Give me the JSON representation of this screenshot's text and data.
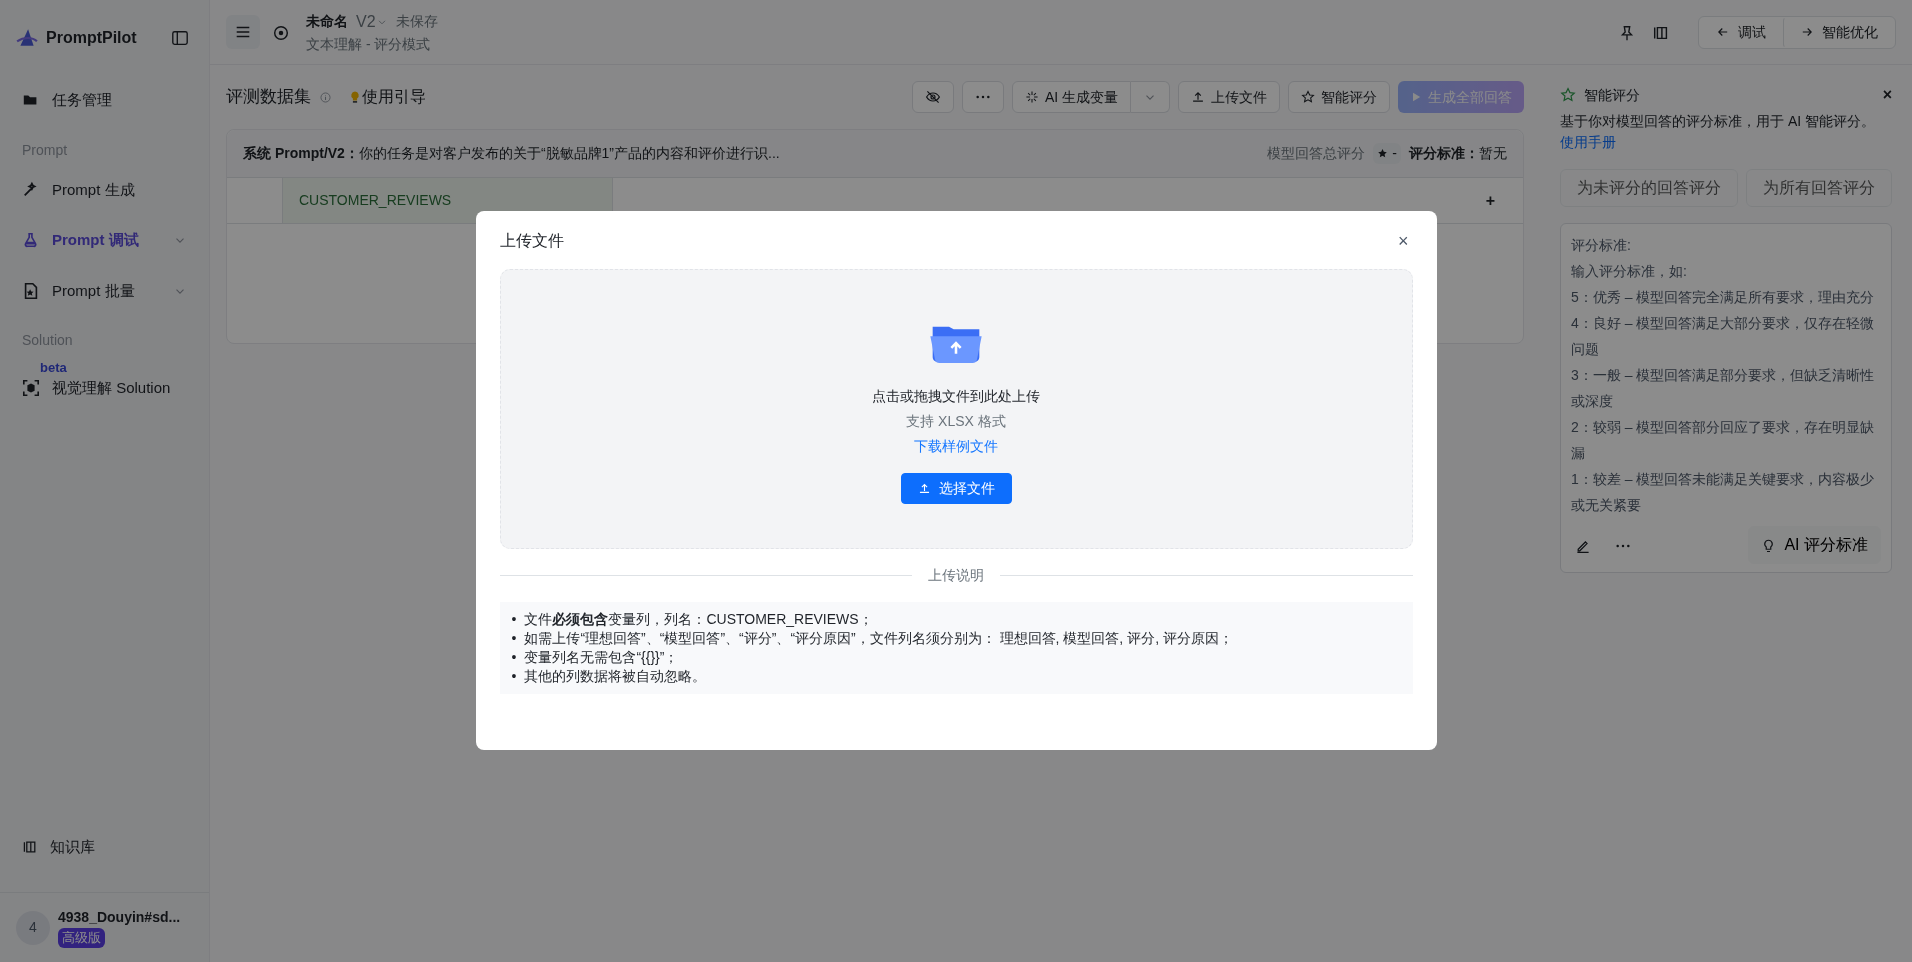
{
  "sidebar": {
    "logo": "PromptPilot",
    "items": [
      {
        "label": "任务管理",
        "selected": false,
        "collapsible": false
      },
      {
        "section": "Prompt"
      },
      {
        "label": "Prompt 生成",
        "selected": false,
        "collapsible": false
      },
      {
        "label": "Prompt 调试",
        "selected": true,
        "collapsible": true
      },
      {
        "label": "Prompt 批量",
        "selected": false,
        "collapsible": true
      },
      {
        "section": "Solution"
      },
      {
        "label": "视觉理解 Solution",
        "selected": false,
        "collapsible": false,
        "badge": "beta"
      }
    ],
    "bottom_item": {
      "label": "知识库"
    },
    "user": {
      "avatar": "4",
      "name": "4938_Douyin#sd...",
      "plan": "高级版"
    }
  },
  "header": {
    "title": "未命名",
    "version": "V2",
    "status": "未保存",
    "subtitle": "文本理解 - 评分模式",
    "buttons": [
      {
        "label": "调试"
      },
      {
        "label": "智能优化"
      }
    ]
  },
  "dataset": {
    "title": "评测数据集",
    "guide": "使用引导",
    "toolbar": [
      {
        "kind": "icon"
      },
      {
        "kind": "icon"
      },
      {
        "kind": "split",
        "label": "AI 生成变量"
      },
      {
        "kind": "button",
        "label": "上传文件"
      },
      {
        "kind": "button",
        "label": "智能评分"
      },
      {
        "kind": "primary",
        "label": "生成全部回答",
        "disabled": true
      }
    ],
    "prompt_label": "系统 Prompt/V2：",
    "prompt_text": "你的任务是对客户发布的关于“脱敏品牌1”产品的内容和评价进行识...",
    "score_label": "模型回答总评分",
    "score": "-",
    "criteria_label": "评分标准：",
    "criteria_value": "暂无",
    "columns": [
      {
        "label": "CUSTOMER_REVIEWS"
      }
    ],
    "add_column": "+"
  },
  "scoring_panel": {
    "title": "智能评分",
    "description": "基于你对模型回答的评分标准，用于 AI 智能评分。",
    "link": "使用手册",
    "buttons": [
      {
        "label": "为未评分的回答评分",
        "disabled": true
      },
      {
        "label": "为所有回答评分",
        "disabled": true
      }
    ],
    "criteria": [
      "评分标准:",
      "输入评分标准，如:",
      "5：优秀 – 模型回答完全满足所有要求，理由充分",
      "4：良好 – 模型回答满足大部分要求，仅存在轻微问题",
      "3：一般 – 模型回答满足部分要求，但缺乏清晰性或深度",
      "2：较弱 – 模型回答部分回应了要求，存在明显缺漏",
      "1：较差 – 模型回答未能满足关键要求，内容极少或无关紧要"
    ],
    "ai_button": "AI 评分标准"
  },
  "modal": {
    "title": "上传文件",
    "close": "×",
    "drop_text": "点击或拖拽文件到此处上传",
    "formats": "支持 XLSX 格式",
    "sample_link": "下载样例文件",
    "choose_button": "选择文件",
    "divider": "上传说明",
    "notes": [
      {
        "bullet": "•",
        "text": "文件**必须包含**变量列，列名：CUSTOMER_REVIEWS；"
      },
      {
        "bullet": "•",
        "text": "如需上传“理想回答”、“模型回答”、“评分”、“评分原因”，文件列名须分别为： 理想回答, 模型回答, 评分, 评分原因；"
      },
      {
        "bullet": "•",
        "text": "变量列名无需包含“{{}}”；"
      },
      {
        "bullet": "•",
        "text": "其他的列数据将被自动忽略。"
      }
    ]
  }
}
